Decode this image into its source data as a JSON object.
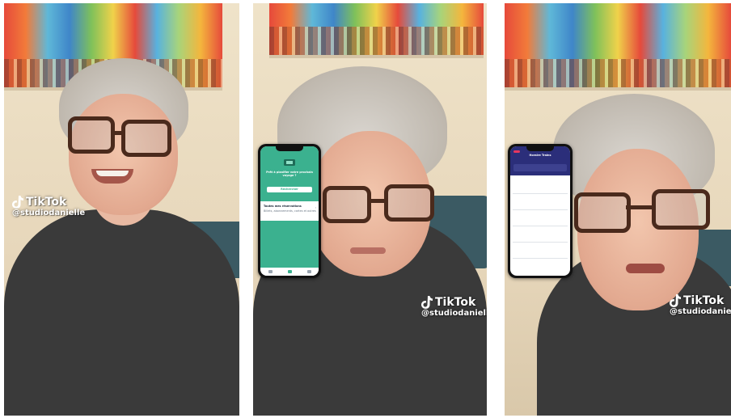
{
  "watermarks": [
    {
      "logo_text": "TikTok",
      "handle": "@studiodanielle"
    },
    {
      "logo_text": "TikTok",
      "handle": "@studiodanielle"
    },
    {
      "logo_text": "TikTok",
      "handle": "@studiodanielle"
    }
  ],
  "phone1": {
    "question": "Prêt à planifier votre prochain voyage ?",
    "cta": "Rechercher",
    "section_title": "Toutes mes réservations",
    "section_subtitle": "Billets, abonnements, cartes et autres"
  },
  "phone2": {
    "title": "Horaire Trains"
  },
  "icons": {
    "tiktok": "tiktok-logo-icon",
    "ticket": "ticket-icon"
  },
  "colors": {
    "sncf_green": "#3bb18f",
    "sncf_navy": "#2b2e7a"
  }
}
